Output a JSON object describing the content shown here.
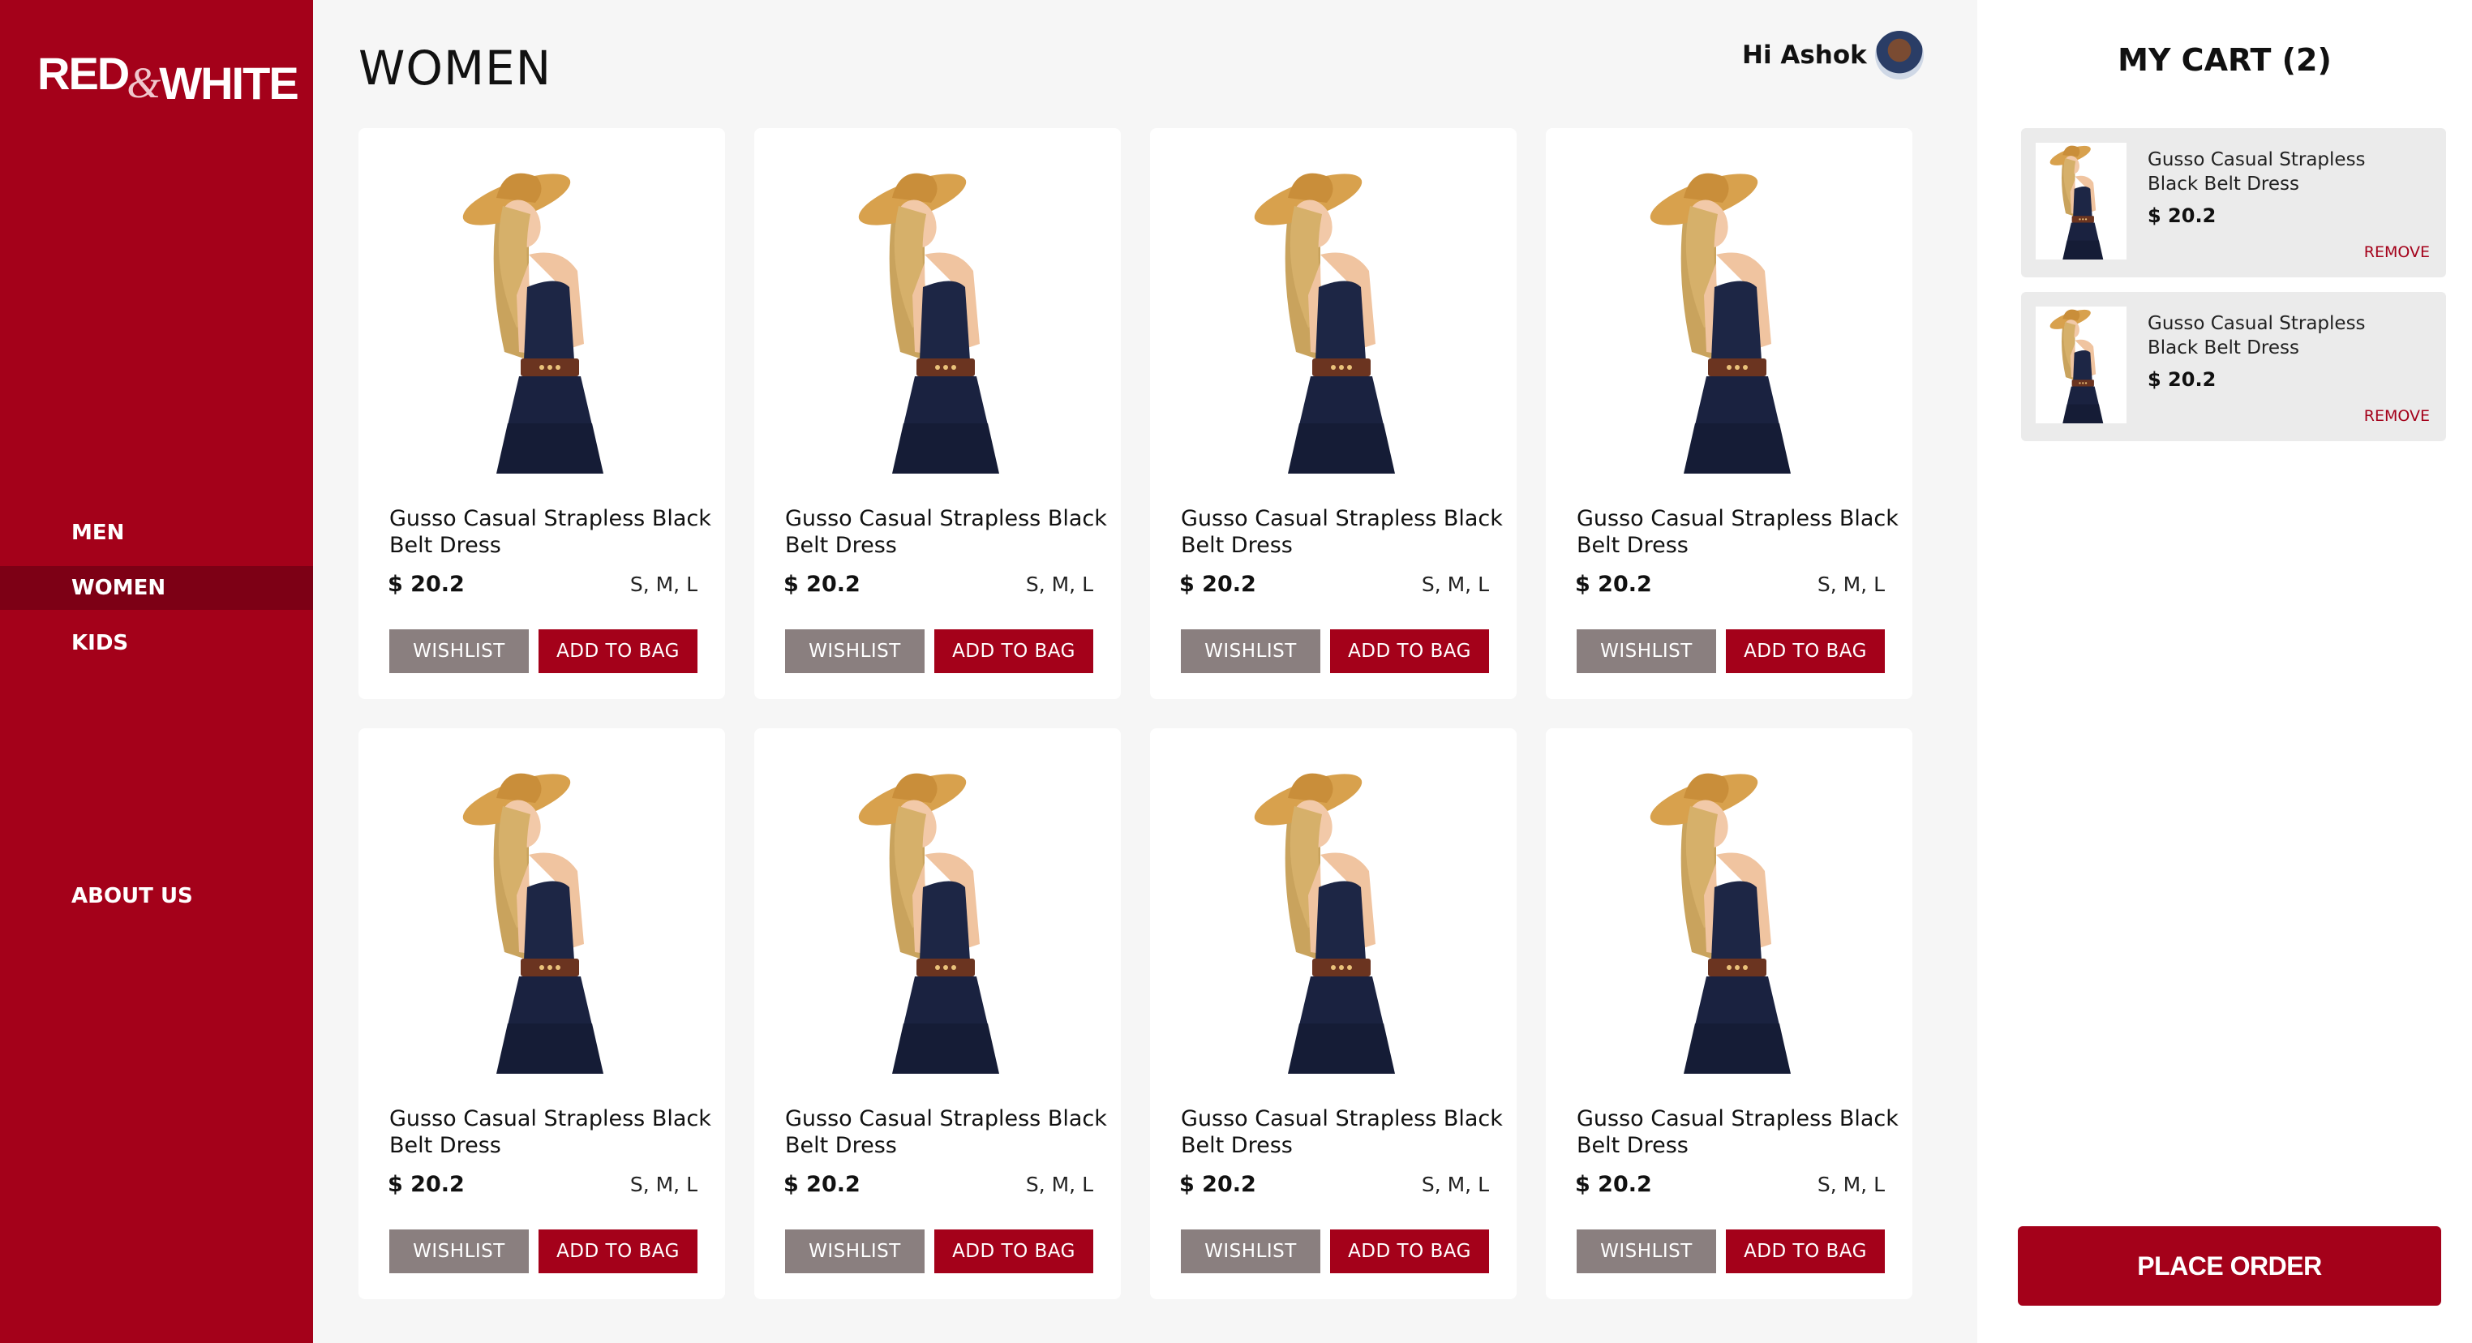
{
  "brand": {
    "part1": "RED",
    "amp": "&",
    "part2": "WHITE",
    "color": "#a4011a"
  },
  "nav": [
    {
      "label": "MEN",
      "active": false
    },
    {
      "label": "WOMEN",
      "active": true
    },
    {
      "label": "KIDS",
      "active": false
    },
    {
      "label": "ABOUT US",
      "active": false
    }
  ],
  "header": {
    "title": "WOMEN",
    "greeting": "Hi Ashok"
  },
  "products": [
    {
      "name": "Gusso Casual Strapless Black Belt Dress",
      "price": "$ 20.2",
      "sizes": "S, M, L",
      "wishlist_label": "WISHLIST",
      "add_label": "ADD TO BAG"
    },
    {
      "name": "Gusso Casual Strapless Black Belt Dress",
      "price": "$ 20.2",
      "sizes": "S, M, L",
      "wishlist_label": "WISHLIST",
      "add_label": "ADD TO BAG"
    },
    {
      "name": "Gusso Casual Strapless Black Belt Dress",
      "price": "$ 20.2",
      "sizes": "S, M, L",
      "wishlist_label": "WISHLIST",
      "add_label": "ADD TO BAG"
    },
    {
      "name": "Gusso Casual Strapless Black Belt Dress",
      "price": "$ 20.2",
      "sizes": "S, M, L",
      "wishlist_label": "WISHLIST",
      "add_label": "ADD TO BAG"
    },
    {
      "name": "Gusso Casual Strapless Black Belt Dress",
      "price": "$ 20.2",
      "sizes": "S, M, L",
      "wishlist_label": "WISHLIST",
      "add_label": "ADD TO BAG"
    },
    {
      "name": "Gusso Casual Strapless Black Belt Dress",
      "price": "$ 20.2",
      "sizes": "S, M, L",
      "wishlist_label": "WISHLIST",
      "add_label": "ADD TO BAG"
    },
    {
      "name": "Gusso Casual Strapless Black Belt Dress",
      "price": "$ 20.2",
      "sizes": "S, M, L",
      "wishlist_label": "WISHLIST",
      "add_label": "ADD TO BAG"
    },
    {
      "name": "Gusso Casual Strapless Black Belt Dress",
      "price": "$ 20.2",
      "sizes": "S, M, L",
      "wishlist_label": "WISHLIST",
      "add_label": "ADD TO BAG"
    }
  ],
  "cart": {
    "title": "MY CART (2)",
    "items": [
      {
        "name": "Gusso Casual Strapless Black Belt Dress",
        "price": "$ 20.2",
        "remove_label": "REMOVE"
      },
      {
        "name": "Gusso Casual Strapless Black Belt Dress",
        "price": "$ 20.2",
        "remove_label": "REMOVE"
      }
    ],
    "place_order_label": "PLACE ORDER"
  }
}
